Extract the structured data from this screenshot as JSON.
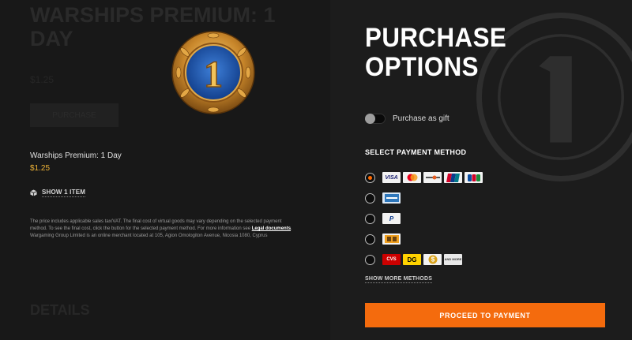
{
  "background": {
    "title": "WARSHIPS PREMIUM: 1 DAY",
    "price": "$1.25",
    "button_label": "PURCHASE",
    "details_heading": "DETAILS"
  },
  "medal": {
    "number": "1"
  },
  "product": {
    "name": "Warships Premium: 1 Day",
    "price": "$1.25",
    "show_items_label": "SHOW 1 ITEM"
  },
  "disclaimer": {
    "text": "The price includes applicable sales tax/VAT. The final cost of virtual goods may vary depending on the selected payment method. To see the final cost, click the button for the selected payment method. For more information see ",
    "link": "Legal documents",
    "text2": ". Wargaming Group Limited is an online merchant located at 105, Agion Omologiton Avenue, Nicosia 1080, Cyprus"
  },
  "purchase": {
    "title_line1": "PURCHASE",
    "title_line2": "OPTIONS",
    "gift_label": "Purchase as gift",
    "gift_enabled": false,
    "payment_heading": "SELECT PAYMENT METHOD",
    "methods": [
      {
        "selected": true,
        "cards": [
          {
            "label": "VISA",
            "icon": "visa-icon",
            "color": "#1a1f71"
          },
          {
            "label": "MC",
            "icon": "mastercard-icon",
            "color": "#eb001b"
          },
          {
            "label": "DISC",
            "icon": "discover-icon",
            "color": "#e55c20"
          },
          {
            "label": "UP",
            "icon": "unionpay-icon",
            "color": "#d10429"
          },
          {
            "label": "JCB",
            "icon": "jcb-icon",
            "color": "#0b4ea2"
          }
        ]
      },
      {
        "selected": false,
        "cards": [
          {
            "label": "AMEX",
            "icon": "amex-icon",
            "color": "#2e77bb"
          }
        ]
      },
      {
        "selected": false,
        "cards": [
          {
            "label": "P",
            "icon": "paypal-icon",
            "color": "#003087"
          }
        ]
      },
      {
        "selected": false,
        "cards": [
          {
            "label": "▮▮",
            "icon": "wallet-icon",
            "color": "#f0a020"
          }
        ]
      },
      {
        "selected": false,
        "cards": [
          {
            "label": "CVS",
            "icon": "cvs-icon",
            "color": "#cc0000"
          },
          {
            "label": "DG",
            "icon": "dollar-general-icon",
            "color": "#000000"
          },
          {
            "label": "$",
            "icon": "paynearme-icon",
            "color": "#d9a21b"
          },
          {
            "label": "AND MORE",
            "icon": "and-more-icon",
            "color": "#333333"
          }
        ]
      }
    ],
    "show_more_label": "SHOW MORE METHODS",
    "proceed_label": "PROCEED TO PAYMENT"
  },
  "colors": {
    "accent": "#f46b0d",
    "price": "#f0b437",
    "radio_selected": "#ff6a00"
  }
}
